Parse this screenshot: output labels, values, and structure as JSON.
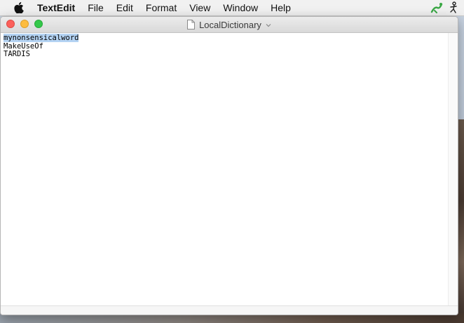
{
  "menubar": {
    "app_name": "TextEdit",
    "items": [
      "File",
      "Edit",
      "Format",
      "View",
      "Window",
      "Help"
    ],
    "apple_icon": "apple-icon",
    "tray_icons": [
      "splashtop-icon",
      "accessibility-icon"
    ]
  },
  "window": {
    "title": "LocalDictionary",
    "doc_icon": "document-icon",
    "chevron_icon": "chevron-down-icon",
    "lines": [
      "mynonsensicalword",
      "MakeUseOf",
      "TARDIS"
    ],
    "selected_line_index": 0
  },
  "colors": {
    "selection": "#b4d3f3",
    "close": "#fc605b",
    "minimize": "#fdbc40",
    "maximize": "#34c84a"
  }
}
